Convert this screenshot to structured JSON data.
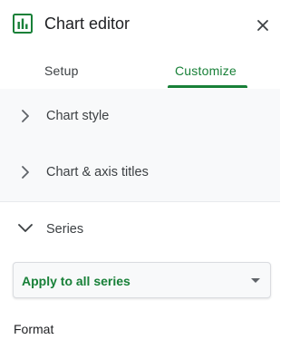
{
  "header": {
    "title": "Chart editor",
    "icon": "chart-editor-icon",
    "close_icon": "close-icon"
  },
  "tabs": [
    {
      "label": "Setup",
      "active": false
    },
    {
      "label": "Customize",
      "active": true
    }
  ],
  "sections": [
    {
      "label": "Chart style",
      "expanded": false,
      "icon": "chevron-right-icon"
    },
    {
      "label": "Chart & axis titles",
      "expanded": false,
      "icon": "chevron-right-icon"
    },
    {
      "label": "Series",
      "expanded": true,
      "icon": "chevron-down-icon"
    }
  ],
  "series": {
    "selector_value": "Apply to all series",
    "selector_icon": "dropdown-arrow-icon",
    "format_label": "Format"
  },
  "colors": {
    "accent": "#188038",
    "panel_background": "#f8f9fa",
    "text_primary": "#202124",
    "text_secondary": "#3c4043"
  }
}
